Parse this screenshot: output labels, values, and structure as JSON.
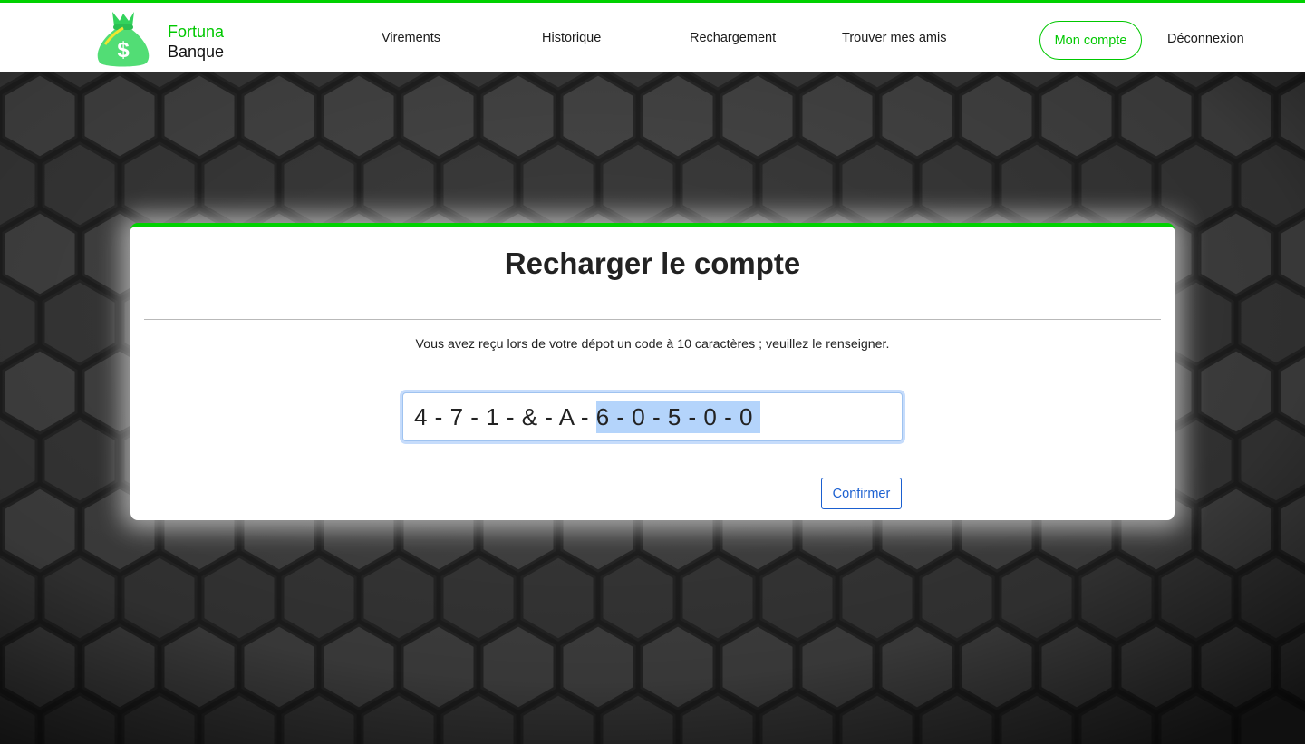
{
  "brand": {
    "line1": "Fortuna",
    "line2": "Banque",
    "logo_icon": "money-bag-icon",
    "accent_color": "#00d100"
  },
  "nav": {
    "items": [
      {
        "label": "Virements"
      },
      {
        "label": "Historique"
      },
      {
        "label": "Rechargement"
      },
      {
        "label": "Trouver mes amis"
      }
    ],
    "account_label": "Mon compte",
    "logout_label": "Déconnexion"
  },
  "card": {
    "title": "Recharger le compte",
    "instruction": "Vous avez reçu lors de votre dépot un code à 10 caractères ; veuillez le renseigner.",
    "code_unselected": "4 - 7 - 1 - & - A - ",
    "code_selected": "6 - 0 - 5 - 0 - 0",
    "confirm_label": "Confirmer",
    "confirm_color": "#1a5fd0"
  }
}
